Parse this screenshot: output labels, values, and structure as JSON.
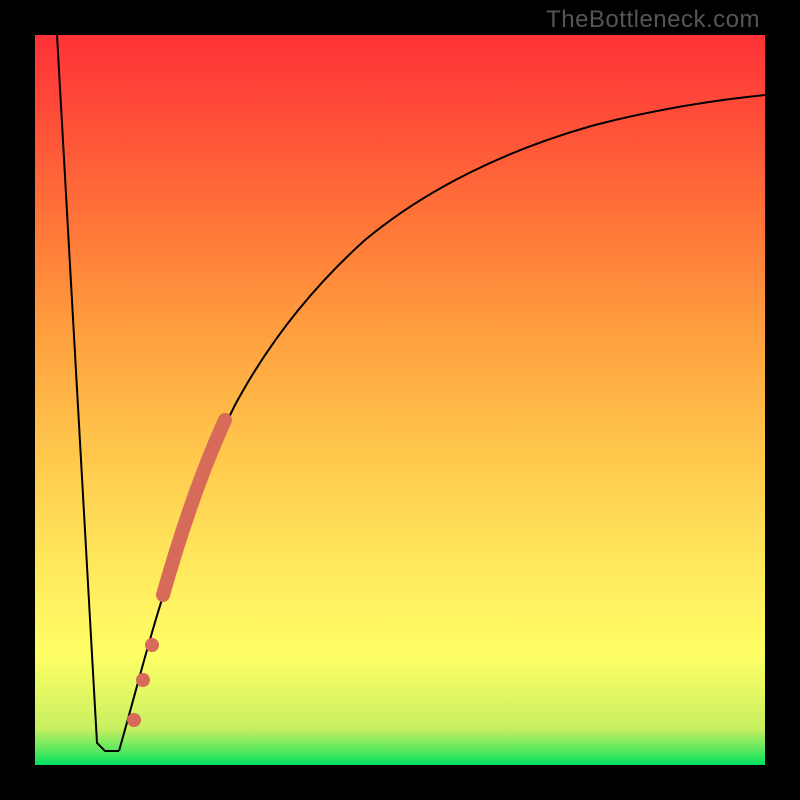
{
  "watermark": "TheBottleneck.com",
  "chart_data": {
    "type": "line",
    "title": "",
    "xlabel": "",
    "ylabel": "",
    "xlim": [
      0,
      100
    ],
    "ylim": [
      0,
      100
    ],
    "grid": false,
    "legend": false,
    "series": [
      {
        "name": "left-edge",
        "stroke": "#000000",
        "x": [
          3,
          8.5,
          9.5,
          11.5
        ],
        "y": [
          100,
          3,
          2,
          2
        ]
      },
      {
        "name": "main-curve",
        "stroke": "#000000",
        "x": [
          11.5,
          14,
          17,
          20,
          23,
          27,
          32,
          38,
          45,
          55,
          70,
          85,
          100
        ],
        "y": [
          2,
          11,
          22,
          33,
          43,
          52,
          61,
          69,
          76,
          82,
          87,
          90,
          92
        ]
      }
    ],
    "highlight_segment": {
      "name": "highlight",
      "stroke": "#d86a5a",
      "x": [
        13.5,
        14.2,
        15.2,
        16.2,
        17.5,
        21.5,
        25.5
      ],
      "y": [
        6,
        10,
        14,
        17,
        22,
        36,
        48
      ]
    },
    "highlight_dots": {
      "name": "highlight-dots",
      "fill": "#d86a5a",
      "points": [
        {
          "x": 13.5,
          "y": 6
        },
        {
          "x": 14.8,
          "y": 12
        },
        {
          "x": 16.0,
          "y": 16
        }
      ]
    }
  }
}
